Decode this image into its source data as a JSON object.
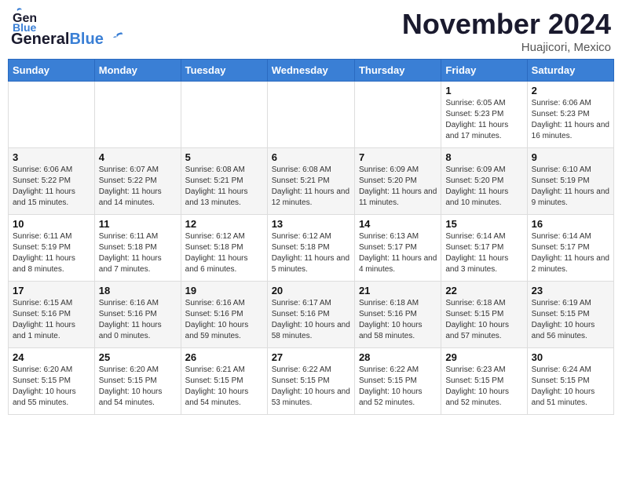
{
  "header": {
    "logo_text_general": "General",
    "logo_text_blue": "Blue",
    "month_title": "November 2024",
    "location": "Huajicori, Mexico"
  },
  "calendar": {
    "weekdays": [
      "Sunday",
      "Monday",
      "Tuesday",
      "Wednesday",
      "Thursday",
      "Friday",
      "Saturday"
    ],
    "weeks": [
      [
        {
          "day": "",
          "info": ""
        },
        {
          "day": "",
          "info": ""
        },
        {
          "day": "",
          "info": ""
        },
        {
          "day": "",
          "info": ""
        },
        {
          "day": "",
          "info": ""
        },
        {
          "day": "1",
          "info": "Sunrise: 6:05 AM\nSunset: 5:23 PM\nDaylight: 11 hours and 17 minutes."
        },
        {
          "day": "2",
          "info": "Sunrise: 6:06 AM\nSunset: 5:23 PM\nDaylight: 11 hours and 16 minutes."
        }
      ],
      [
        {
          "day": "3",
          "info": "Sunrise: 6:06 AM\nSunset: 5:22 PM\nDaylight: 11 hours and 15 minutes."
        },
        {
          "day": "4",
          "info": "Sunrise: 6:07 AM\nSunset: 5:22 PM\nDaylight: 11 hours and 14 minutes."
        },
        {
          "day": "5",
          "info": "Sunrise: 6:08 AM\nSunset: 5:21 PM\nDaylight: 11 hours and 13 minutes."
        },
        {
          "day": "6",
          "info": "Sunrise: 6:08 AM\nSunset: 5:21 PM\nDaylight: 11 hours and 12 minutes."
        },
        {
          "day": "7",
          "info": "Sunrise: 6:09 AM\nSunset: 5:20 PM\nDaylight: 11 hours and 11 minutes."
        },
        {
          "day": "8",
          "info": "Sunrise: 6:09 AM\nSunset: 5:20 PM\nDaylight: 11 hours and 10 minutes."
        },
        {
          "day": "9",
          "info": "Sunrise: 6:10 AM\nSunset: 5:19 PM\nDaylight: 11 hours and 9 minutes."
        }
      ],
      [
        {
          "day": "10",
          "info": "Sunrise: 6:11 AM\nSunset: 5:19 PM\nDaylight: 11 hours and 8 minutes."
        },
        {
          "day": "11",
          "info": "Sunrise: 6:11 AM\nSunset: 5:18 PM\nDaylight: 11 hours and 7 minutes."
        },
        {
          "day": "12",
          "info": "Sunrise: 6:12 AM\nSunset: 5:18 PM\nDaylight: 11 hours and 6 minutes."
        },
        {
          "day": "13",
          "info": "Sunrise: 6:12 AM\nSunset: 5:18 PM\nDaylight: 11 hours and 5 minutes."
        },
        {
          "day": "14",
          "info": "Sunrise: 6:13 AM\nSunset: 5:17 PM\nDaylight: 11 hours and 4 minutes."
        },
        {
          "day": "15",
          "info": "Sunrise: 6:14 AM\nSunset: 5:17 PM\nDaylight: 11 hours and 3 minutes."
        },
        {
          "day": "16",
          "info": "Sunrise: 6:14 AM\nSunset: 5:17 PM\nDaylight: 11 hours and 2 minutes."
        }
      ],
      [
        {
          "day": "17",
          "info": "Sunrise: 6:15 AM\nSunset: 5:16 PM\nDaylight: 11 hours and 1 minute."
        },
        {
          "day": "18",
          "info": "Sunrise: 6:16 AM\nSunset: 5:16 PM\nDaylight: 11 hours and 0 minutes."
        },
        {
          "day": "19",
          "info": "Sunrise: 6:16 AM\nSunset: 5:16 PM\nDaylight: 10 hours and 59 minutes."
        },
        {
          "day": "20",
          "info": "Sunrise: 6:17 AM\nSunset: 5:16 PM\nDaylight: 10 hours and 58 minutes."
        },
        {
          "day": "21",
          "info": "Sunrise: 6:18 AM\nSunset: 5:16 PM\nDaylight: 10 hours and 58 minutes."
        },
        {
          "day": "22",
          "info": "Sunrise: 6:18 AM\nSunset: 5:15 PM\nDaylight: 10 hours and 57 minutes."
        },
        {
          "day": "23",
          "info": "Sunrise: 6:19 AM\nSunset: 5:15 PM\nDaylight: 10 hours and 56 minutes."
        }
      ],
      [
        {
          "day": "24",
          "info": "Sunrise: 6:20 AM\nSunset: 5:15 PM\nDaylight: 10 hours and 55 minutes."
        },
        {
          "day": "25",
          "info": "Sunrise: 6:20 AM\nSunset: 5:15 PM\nDaylight: 10 hours and 54 minutes."
        },
        {
          "day": "26",
          "info": "Sunrise: 6:21 AM\nSunset: 5:15 PM\nDaylight: 10 hours and 54 minutes."
        },
        {
          "day": "27",
          "info": "Sunrise: 6:22 AM\nSunset: 5:15 PM\nDaylight: 10 hours and 53 minutes."
        },
        {
          "day": "28",
          "info": "Sunrise: 6:22 AM\nSunset: 5:15 PM\nDaylight: 10 hours and 52 minutes."
        },
        {
          "day": "29",
          "info": "Sunrise: 6:23 AM\nSunset: 5:15 PM\nDaylight: 10 hours and 52 minutes."
        },
        {
          "day": "30",
          "info": "Sunrise: 6:24 AM\nSunset: 5:15 PM\nDaylight: 10 hours and 51 minutes."
        }
      ]
    ]
  }
}
